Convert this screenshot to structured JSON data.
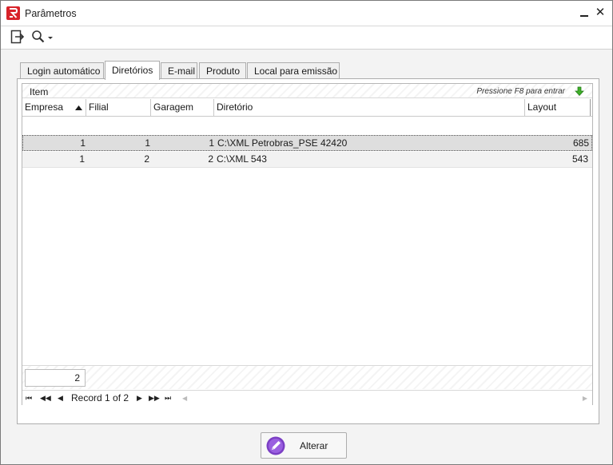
{
  "window": {
    "title": "Parâmetros",
    "minimize_glyph": "_",
    "close_glyph": "✕",
    "brand_color": "#d8232a"
  },
  "toolbar": {
    "exit_icon": "exit-icon",
    "search_icon": "search-icon"
  },
  "tabs": [
    {
      "label": "Login automático",
      "active": false
    },
    {
      "label": "Diretórios",
      "active": true
    },
    {
      "label": "E-mail",
      "active": false
    },
    {
      "label": "Produto",
      "active": false
    },
    {
      "label": "Local para emissão",
      "active": false
    }
  ],
  "grid": {
    "band_label": "Item",
    "hint": "Pressione F8 para entrar",
    "hint_icon": "green-down-arrow-icon",
    "columns": [
      "Empresa",
      "Filial",
      "Garagem",
      "Diretório",
      "Layout"
    ],
    "sort_column": "Empresa",
    "rows": [
      {
        "empresa": "1",
        "filial": "1",
        "garagem": "1",
        "diretorio": "C:\\XML Petrobras_PSE 42420",
        "layout": "685",
        "selected": true
      },
      {
        "empresa": "1",
        "filial": "2",
        "garagem": "2",
        "diretorio": "C:\\XML 543",
        "layout": "543",
        "selected": false
      }
    ],
    "summary_count": "2",
    "navigator_text": "Record 1 of 2"
  },
  "actions": {
    "alterar_label": "Alterar"
  }
}
